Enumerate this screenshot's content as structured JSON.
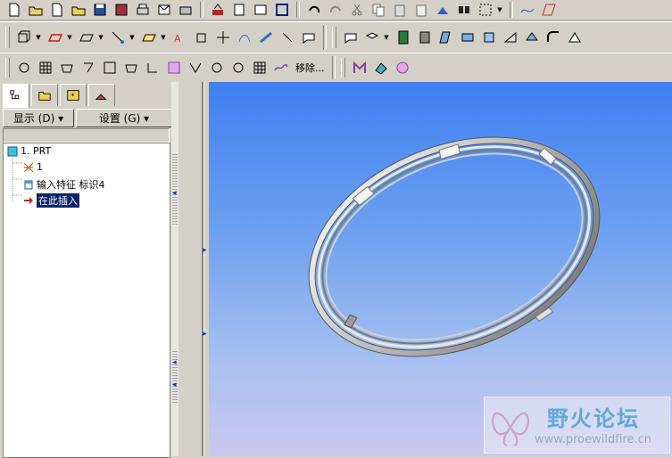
{
  "toolbar3": {
    "move_label": "移除..."
  },
  "panel": {
    "show_menu": "显示 (D) ▾",
    "settings_menu": "设置 (G) ▾"
  },
  "tree": {
    "root": "1. PRT",
    "items": [
      {
        "label": "1",
        "icon": "csys-icon"
      },
      {
        "label": "输入特征 标识4",
        "icon": "import-feature-icon"
      },
      {
        "label": "在此插入",
        "icon": "insert-here-arrow-icon",
        "selected": true
      }
    ]
  },
  "watermark": {
    "title": "野火论坛",
    "url": "www.proewildfire.cn"
  },
  "colors": {
    "selection": "#0a246a",
    "viewport_top": "#3e7ff2",
    "viewport_bottom": "#ccc8f0"
  }
}
